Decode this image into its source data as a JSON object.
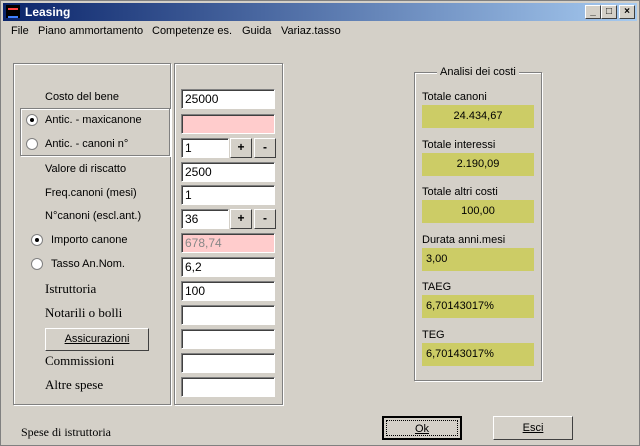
{
  "window": {
    "title": "Leasing"
  },
  "menu": [
    "File",
    "Piano ammortamento",
    "Competenze es.",
    "Guida",
    "Variaz.tasso"
  ],
  "form": {
    "costo_bene": {
      "label": "Costo del bene",
      "value": "25000"
    },
    "antic_maxi": {
      "label": "Antic. - maxicanone",
      "value": ""
    },
    "antic_canoni": {
      "label": "Antic. - canoni n°",
      "value": "1"
    },
    "valore_riscatto": {
      "label": "Valore di riscatto",
      "value": "2500"
    },
    "freq_canoni": {
      "label": "Freq.canoni (mesi)",
      "value": "1"
    },
    "n_canoni": {
      "label": "N°canoni (escl.ant.)",
      "value": "36"
    },
    "importo_canone": {
      "label": "Importo canone",
      "value": "678,74"
    },
    "tasso": {
      "label": "Tasso An.Nom.",
      "value": "6,2"
    },
    "istruttoria": {
      "label": "Istruttoria",
      "value": "100"
    },
    "notarili": {
      "label": "Notarili o bolli",
      "value": ""
    },
    "assicurazioni": {
      "label": "Assicurazioni",
      "value": ""
    },
    "commissioni": {
      "label": "Commissioni",
      "value": ""
    },
    "altre_spese": {
      "label": "Altre spese",
      "value": ""
    },
    "plus": "+",
    "minus": "-"
  },
  "analisi": {
    "title": "Analisi dei costi",
    "totale_canoni": {
      "label": "Totale canoni",
      "value": "24.434,67"
    },
    "totale_interessi": {
      "label": "Totale interessi",
      "value": "2.190,09"
    },
    "totale_altri": {
      "label": "Totale altri costi",
      "value": "100,00"
    },
    "durata": {
      "label": "Durata anni.mesi",
      "value": "3,00"
    },
    "taeg": {
      "label": "TAEG",
      "value": "6,70143017%"
    },
    "teg": {
      "label": "TEG",
      "value": "6,70143017%"
    }
  },
  "status": "Spese di istruttoria",
  "buttons": {
    "ok": "Ok",
    "esci": "Esci"
  },
  "colors": {
    "result_bg": "#cccc66",
    "pink_field": "#ffcccc",
    "title_start": "#0a246a"
  }
}
